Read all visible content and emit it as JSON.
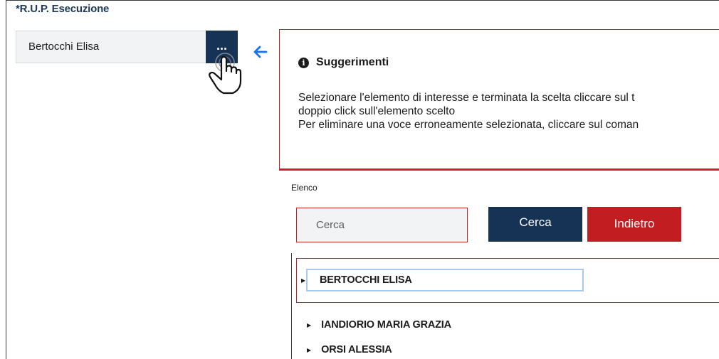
{
  "rup_field": {
    "label": "*R.U.P. Esecuzione",
    "value": "Bertocchi Elisa",
    "lookup_button_label": "...",
    "back_icon": "arrow-left-icon"
  },
  "hints": {
    "icon": "info-circle-icon",
    "title": "Suggerimenti",
    "lines": [
      "Selezionare l'elemento di interesse e terminata la scelta cliccare sul t",
      "doppio click sull'elemento scelto",
      "Per eliminare una voce erroneamente selezionata, cliccare sul coman"
    ]
  },
  "list": {
    "label": "Elenco",
    "search_placeholder": "Cerca",
    "search_button": "Cerca",
    "back_button": "Indietro",
    "items": [
      "BERTOCCHI ELISA",
      "IANDIORIO MARIA GRAZIA",
      "ORSI ALESSIA"
    ],
    "selected_index": 0
  },
  "colors": {
    "primary": "#163356",
    "danger": "#c21e21",
    "border_red": "#c8242b",
    "accent_blue": "#1a73e8"
  }
}
